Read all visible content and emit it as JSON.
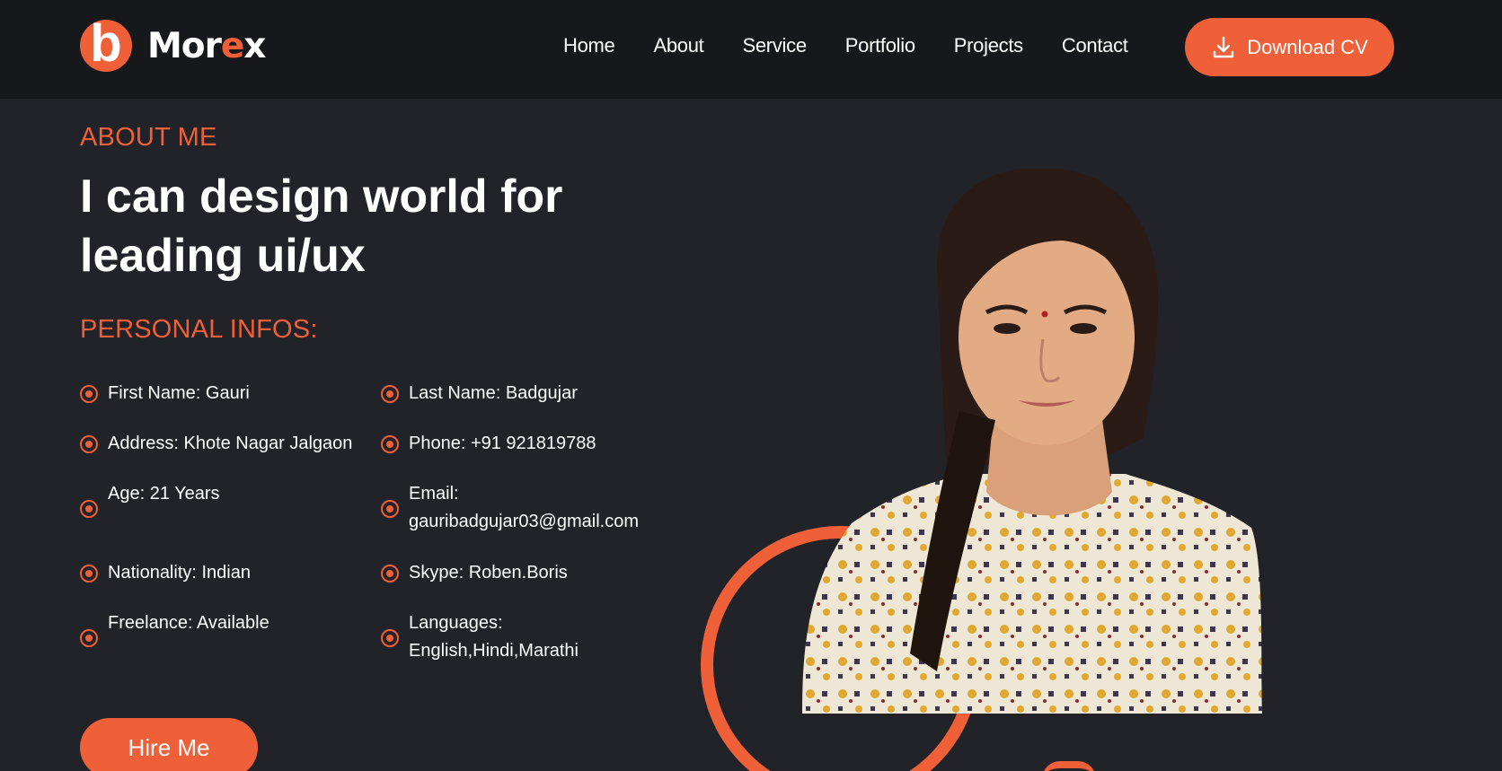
{
  "brand": {
    "logo_letter": "b",
    "name_start": "Mor",
    "name_accent": "e",
    "name_end": "x"
  },
  "nav": {
    "items": [
      {
        "label": "Home"
      },
      {
        "label": "About"
      },
      {
        "label": "Service"
      },
      {
        "label": "Portfolio"
      },
      {
        "label": "Projects"
      },
      {
        "label": "Contact"
      }
    ],
    "cta_label": "Download CV",
    "cta_icon": "download-icon"
  },
  "about": {
    "section_label": "ABOUT ME",
    "headline_line1": "I can design world for",
    "headline_line2": "leading ui/ux",
    "info_heading": "PERSONAL INFOS:",
    "info_left": [
      {
        "text": "First Name: Gauri"
      },
      {
        "text": "Address: Khote Nagar Jalgaon"
      },
      {
        "text": "Age: 21 Years"
      },
      {
        "text": "Nationality: Indian"
      },
      {
        "text": "Freelance: Available"
      }
    ],
    "info_right": [
      {
        "text": "Last Name: Badgujar"
      },
      {
        "text": "Phone: +91 921819788"
      },
      {
        "line1": "Email:",
        "line2": "gauribadgujar03@gmail.com"
      },
      {
        "text": "Skype: Roben.Boris"
      },
      {
        "line1": "Languages:",
        "line2": "English,Hindi,Marathi"
      }
    ],
    "hire_label": "Hire Me"
  },
  "colors": {
    "accent": "#f06038",
    "background": "#212328",
    "header": "#17181c",
    "text": "#ffffff"
  }
}
